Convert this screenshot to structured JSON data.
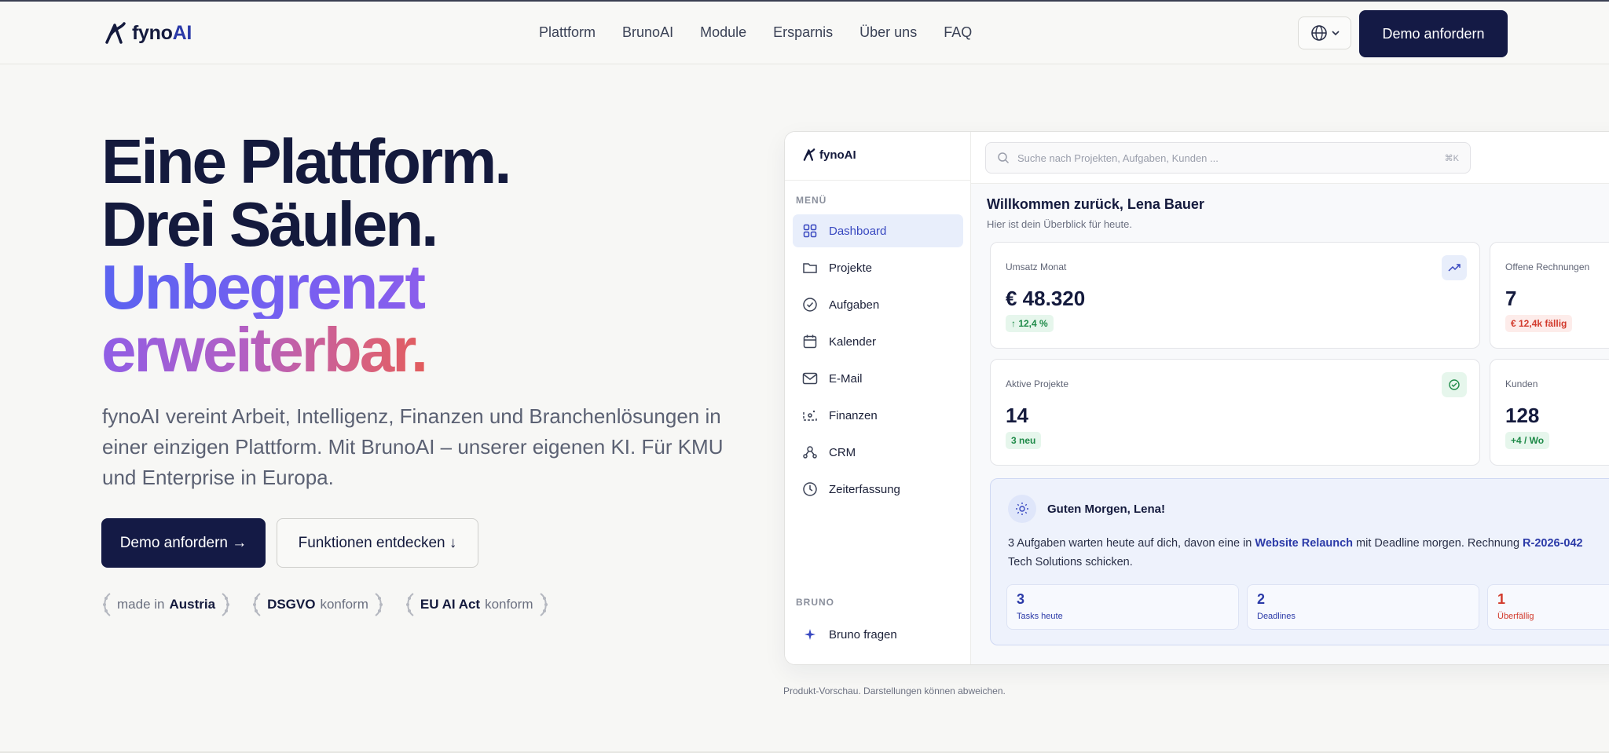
{
  "nav": {
    "logo": {
      "name": "fyno",
      "suffix": "AI"
    },
    "links": [
      "Plattform",
      "BrunoAI",
      "Module",
      "Ersparnis",
      "Über uns",
      "FAQ"
    ],
    "cta": "Demo anfordern"
  },
  "hero": {
    "line1": "Eine Plattform.",
    "line2": "Drei Säulen.",
    "line3": "Unbegrenzt",
    "line4": "erweiterbar.",
    "subtitle": "fynoAI vereint Arbeit, Intelligenz, Finanzen und Branchenlösungen in einer einzigen Plattform. Mit BrunoAI – unserer eigenen KI. Für KMU und Enterprise in Europa.",
    "primary_button": "Demo anfordern →",
    "secondary_button": "Funktionen entdecken ↓",
    "badges": [
      {
        "pre": "made in",
        "bold": "Austria",
        "post": ""
      },
      {
        "pre": "",
        "bold": "DSGVO",
        "post": "konform"
      },
      {
        "pre": "",
        "bold": "EU AI Act",
        "post": "konform"
      }
    ]
  },
  "app": {
    "logo": "fynoAI",
    "search_placeholder": "Suche nach Projekten, Aufgaben, Kunden ...",
    "search_shortcut": "⌘K",
    "menu_heading": "MENÜ",
    "menu": [
      "Dashboard",
      "Projekte",
      "Aufgaben",
      "Kalender",
      "E-Mail",
      "Finanzen",
      "CRM",
      "Zeiterfassung"
    ],
    "bruno_heading": "BRUNO",
    "bruno_item": "Bruno fragen",
    "welcome": "Willkommen zurück, Lena Bauer",
    "welcome_sub": "Hier ist dein Überblick für heute.",
    "cards": [
      {
        "label": "Umsatz Monat",
        "value": "€ 48.320",
        "pill": "↑ 12,4 %"
      },
      {
        "label": "Offene Rechnungen",
        "value": "7",
        "pill": "€ 12,4k fällig"
      },
      {
        "label": "Aktive Projekte",
        "value": "14",
        "pill": "3 neu"
      },
      {
        "label": "Kunden",
        "value": "128",
        "pill": "+4 / Wo"
      }
    ],
    "greeting": {
      "title": "Guten Morgen, Lena!",
      "text_a": "3 Aufgaben warten heute auf dich, davon eine in ",
      "link1": "Website Relaunch",
      "text_b": " mit Deadline morgen. Rechnung ",
      "link2": "R-2026-042",
      "text_c": "Tech Solutions schicken.",
      "stats": [
        {
          "value": "3",
          "label": "Tasks heute"
        },
        {
          "value": "2",
          "label": "Deadlines"
        },
        {
          "value": "1",
          "label": "Überfällig"
        }
      ]
    },
    "note": "Produkt-Vorschau. Darstellungen können abweichen."
  }
}
